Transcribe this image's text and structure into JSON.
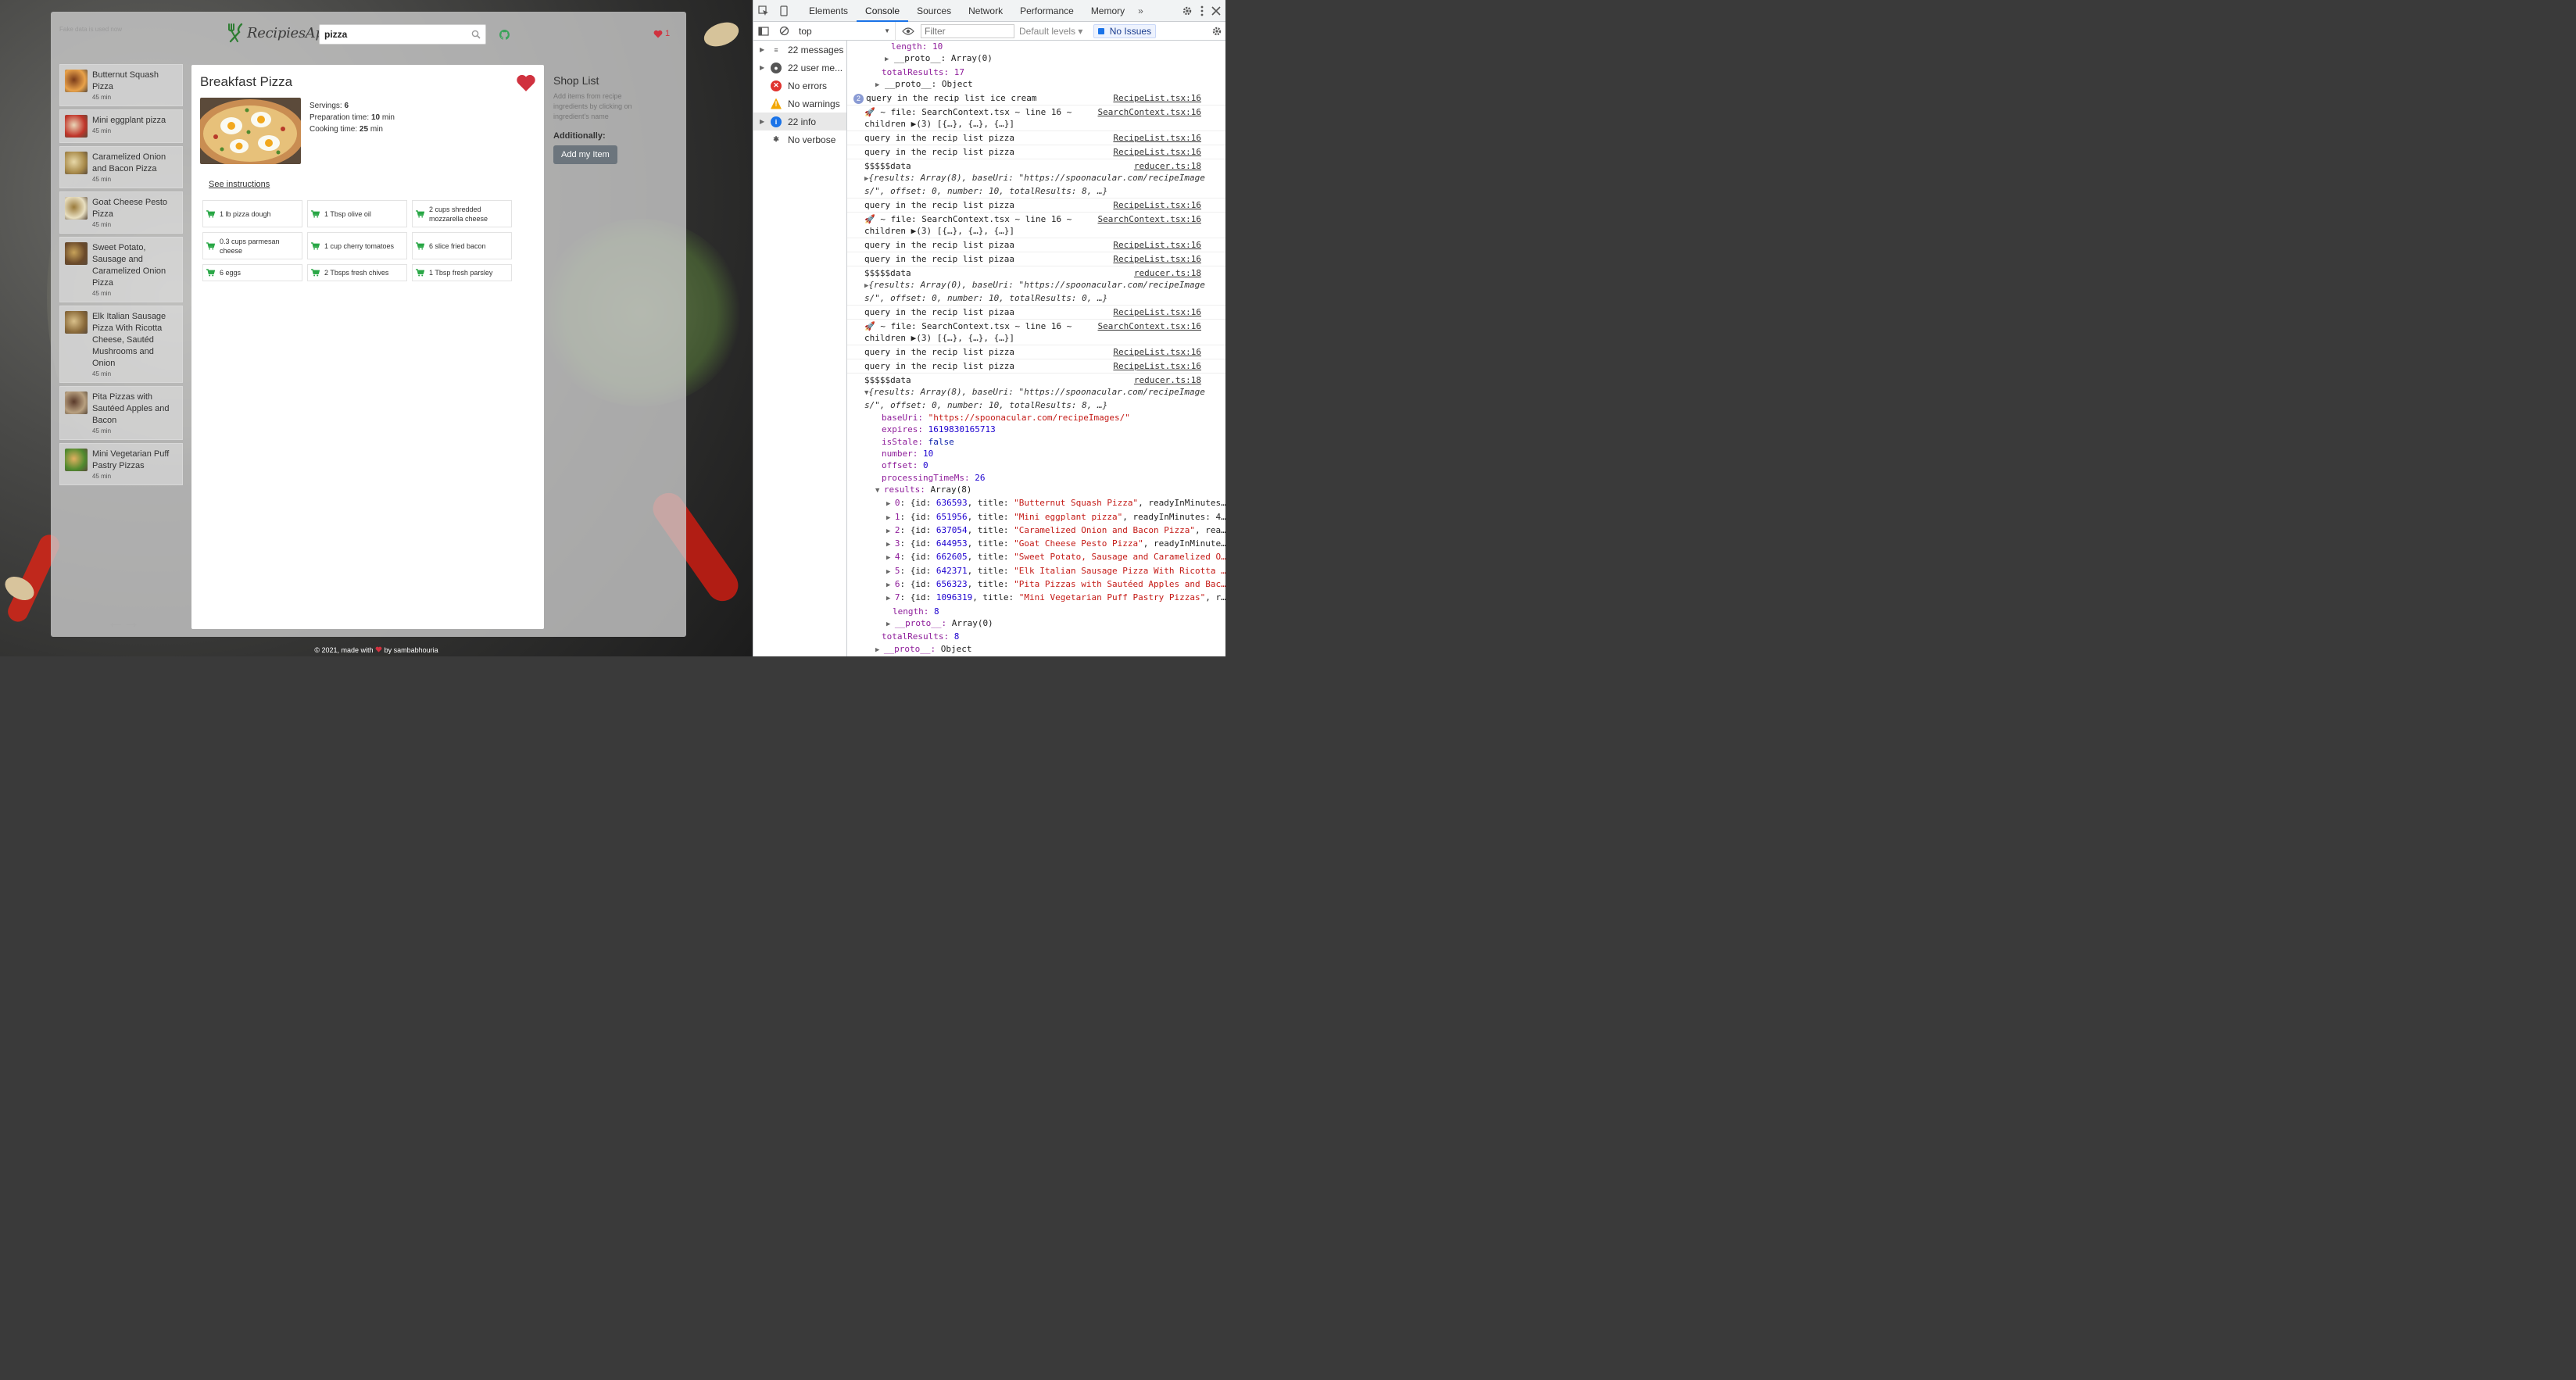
{
  "app": {
    "note": "Fake data is used now",
    "logo_text": "RecipiesApp",
    "search_value": "pizza",
    "fav_count": "1",
    "footer_prefix": "© 2021, made with",
    "footer_suffix": "by sambabhouria"
  },
  "recipes": [
    {
      "title": "Butternut Squash Pizza",
      "time": "45 min"
    },
    {
      "title": "Mini eggplant pizza",
      "time": "45 min"
    },
    {
      "title": "Caramelized Onion and Bacon Pizza",
      "time": "45 min"
    },
    {
      "title": "Goat Cheese Pesto Pizza",
      "time": "45 min"
    },
    {
      "title": "Sweet Potato, Sausage and Caramelized Onion Pizza",
      "time": "45 min"
    },
    {
      "title": "Elk Italian Sausage Pizza With Ricotta Cheese, Sautéd Mushrooms and Onion",
      "time": "45 min"
    },
    {
      "title": "Pita Pizzas with Sautéed Apples and Bacon",
      "time": "45 min"
    },
    {
      "title": "Mini Vegetarian Puff Pastry Pizzas",
      "time": "45 min"
    }
  ],
  "detail": {
    "title": "Breakfast Pizza",
    "servings_label": "Servings:",
    "servings": "6",
    "prep_label": "Preparation time:",
    "prep": "10",
    "cook_label": "Cooking time:",
    "cook": "25",
    "unit": "min",
    "see_instructions": "See instructions",
    "ingredients": [
      "1 lb pizza dough",
      "1 Tbsp olive oil",
      "2 cups shredded mozzarella cheese",
      "0.3 cups parmesan cheese",
      "1 cup cherry tomatoes",
      "6 slice fried bacon",
      "6 eggs",
      "2 Tbsps fresh chives",
      "1 Tbsp fresh parsley"
    ]
  },
  "shop": {
    "title": "Shop List",
    "hint": "Add items from recipe ingredients by clicking on ingredient's name",
    "additionally": "Additionally:",
    "add_button": "Add my Item"
  },
  "devtools": {
    "tabs": [
      "Elements",
      "Console",
      "Sources",
      "Network",
      "Performance",
      "Memory"
    ],
    "active_tab": "Console",
    "more": "»",
    "context": "top",
    "filter_placeholder": "Filter",
    "levels": "Default levels ▾",
    "issues": "No Issues",
    "sidebar": [
      {
        "label": "22 messages",
        "icon": "list-icon"
      },
      {
        "label": "22 user me...",
        "icon": "user-icon"
      },
      {
        "label": "No errors",
        "icon": "error-icon"
      },
      {
        "label": "No warnings",
        "icon": "warning-icon"
      },
      {
        "label": "22 info",
        "icon": "info-icon"
      },
      {
        "label": "No verbose",
        "icon": "bug-icon"
      }
    ],
    "log": {
      "top_length": "length: 10",
      "top_proto1": "__proto__: Array(0)",
      "top_total": "totalResults: 17",
      "top_proto2": "__proto__: Object",
      "repeat_badge": "2",
      "ice_cream": "query in the recip list ice cream",
      "file_line": "🚀 ~ file: SearchContext.tsx ~ line 16 ~",
      "children": "children ▶(3) [{…}, {…}, {…}]",
      "q_pizza": "query in the recip list pizza",
      "q_pizaa": "query in the recip list pizaa",
      "data_label": "$$$$$data",
      "data8_a": "{results: Array(8), baseUri: \"https://spoonacular.com/recipeImage",
      "data8_b": "s/\", offset: 0, number: 10, totalResults: 8, …}",
      "data0_a": "{results: Array(0), baseUri: \"https://spoonacular.com/recipeImage",
      "data0_b": "s/\", offset: 0, number: 10, totalResults: 0, …}",
      "src_recipelist": "RecipeList.tsx:16",
      "src_searchcontext": "SearchContext.tsx:16",
      "src_reducer": "reducer.ts:18",
      "expanded": {
        "baseUri": "\"https://spoonacular.com/recipeImages/\"",
        "expires": "1619830165713",
        "isStale": "false",
        "number": "10",
        "offset": "0",
        "processingTimeMs": "26",
        "results": "Array(8)",
        "items": [
          {
            "i": "0",
            "id": "636593",
            "title": "\"Butternut Squash Pizza\"",
            "rest": ", readyInMinutes…"
          },
          {
            "i": "1",
            "id": "651956",
            "title": "\"Mini eggplant pizza\"",
            "rest": ", readyInMinutes: 4…"
          },
          {
            "i": "2",
            "id": "637054",
            "title": "\"Caramelized Onion and Bacon Pizza\"",
            "rest": ", rea…"
          },
          {
            "i": "3",
            "id": "644953",
            "title": "\"Goat Cheese Pesto Pizza\"",
            "rest": ", readyInMinute…"
          },
          {
            "i": "4",
            "id": "662605",
            "title": "\"Sweet Potato, Sausage and Caramelized O…",
            "rest": ""
          },
          {
            "i": "5",
            "id": "642371",
            "title": "\"Elk Italian Sausage Pizza With Ricotta …",
            "rest": ""
          },
          {
            "i": "6",
            "id": "656323",
            "title": "\"Pita Pizzas with Sautéed Apples and Bac…",
            "rest": ""
          },
          {
            "i": "7",
            "id": "1096319",
            "title": "\"Mini Vegetarian Puff Pastry Pizzas\"",
            "rest": ", r…"
          }
        ],
        "length": "8",
        "proto_array": "Array(0)",
        "totalResults": "8",
        "proto_obj": "Object"
      }
    }
  },
  "colors": {
    "accent_red": "#d0323f",
    "cart_green": "#28a745",
    "devtools_blue": "#1a73e8"
  }
}
